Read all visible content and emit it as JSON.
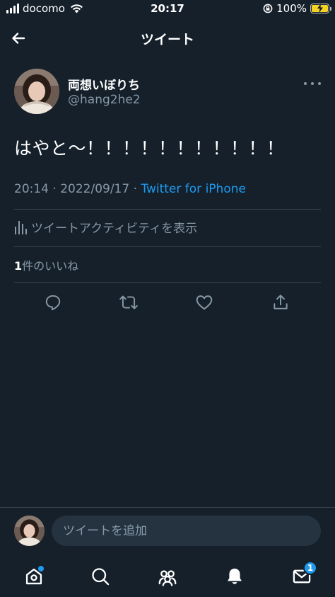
{
  "status_bar": {
    "carrier": "docomo",
    "time": "20:17",
    "battery": "100%"
  },
  "header": {
    "title": "ツイート"
  },
  "tweet": {
    "author_name": "両想いぼりち",
    "author_handle": "@hang2he2",
    "text": "はやと〜！！！！！！！！！！！",
    "timestamp": "20:14 · 2022/09/17 · ",
    "source": "Twitter for iPhone",
    "activity_label": "ツイートアクティビティを表示",
    "likes_count": "1",
    "likes_label": "件のいいね"
  },
  "reply": {
    "placeholder": "ツイートを追加"
  },
  "tab_bar": {
    "messages_badge": "1"
  },
  "colors": {
    "background": "#15202b",
    "accent": "#1d9bf0",
    "secondary_text": "#8899a6",
    "divider": "#38444d"
  }
}
